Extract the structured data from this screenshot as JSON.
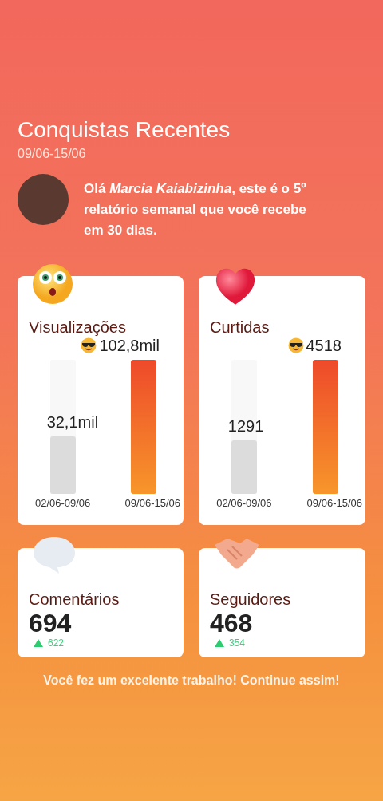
{
  "header": {
    "title": "Conquistas Recentes",
    "period": "09/06-15/06"
  },
  "greeting": {
    "text": "Olá *Marcia Kaiabizinha*, este é o **5**º relatório semanal que você recebe em 30 dias."
  },
  "chart_cards": [
    {
      "kind": "views",
      "title": "Visualizações",
      "bars": [
        {
          "period": "02/06-09/06",
          "value": "32,1mil",
          "level": 0.43,
          "best": false
        },
        {
          "period": "09/06-15/06",
          "value": "102,8mil",
          "level": 1,
          "best": true
        }
      ]
    },
    {
      "kind": "likes",
      "title": "Curtidas",
      "bars": [
        {
          "period": "02/06-09/06",
          "value": "1291",
          "level": 0.4,
          "best": false
        },
        {
          "period": "09/06-15/06",
          "value": "4518",
          "level": 1,
          "best": true
        }
      ]
    }
  ],
  "stat_cards": [
    {
      "kind": "comments",
      "title": "Comentários",
      "value": "694",
      "change": "622"
    },
    {
      "kind": "followers",
      "title": "Seguidores",
      "value": "468",
      "change": "354"
    }
  ],
  "footer": "Você fez um excelente trabalho! Continue assim!"
}
